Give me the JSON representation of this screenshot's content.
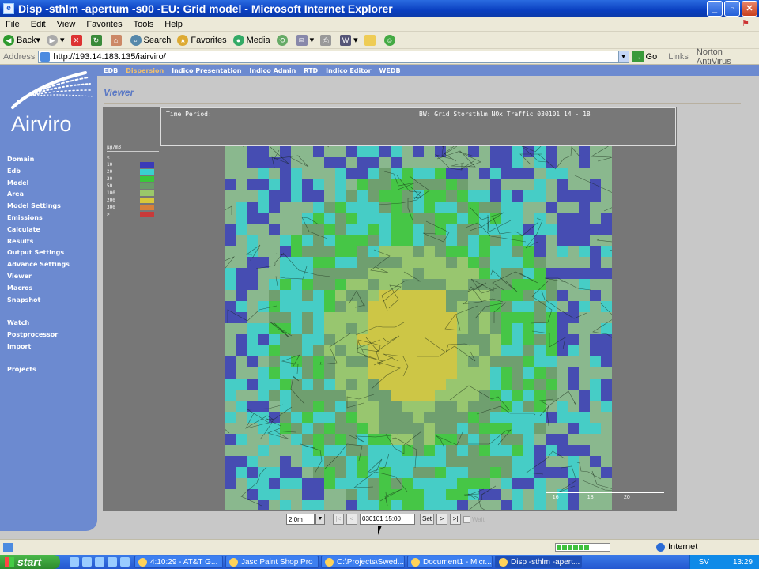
{
  "window": {
    "title": "Disp -sthlm -apertum -s00 -EU: Grid model - Microsoft Internet Explorer"
  },
  "menu": [
    "File",
    "Edit",
    "View",
    "Favorites",
    "Tools",
    "Help"
  ],
  "toolbar": {
    "back": "Back",
    "search": "Search",
    "favorites": "Favorites",
    "media": "Media"
  },
  "address": {
    "label": "Address",
    "url": "http://193.14.183.135/iairviro/",
    "go": "Go",
    "links": "Links",
    "norton": "Norton AntiVirus"
  },
  "app": {
    "logo": "Airviro",
    "section_title": "Viewer"
  },
  "topnav": [
    {
      "label": "EDB",
      "active": false
    },
    {
      "label": "Dispersion",
      "active": true
    },
    {
      "label": "Indico Presentation",
      "active": false
    },
    {
      "label": "Indico Admin",
      "active": false
    },
    {
      "label": "RTD",
      "active": false
    },
    {
      "label": "Indico Editor",
      "active": false
    },
    {
      "label": "WEDB",
      "active": false
    }
  ],
  "sidebar": [
    "Domain",
    "Edb",
    "Model",
    "Area",
    "Model Settings",
    "Emissions",
    "Calculate",
    "Results",
    "Output Settings",
    "Advance Settings",
    "Viewer",
    "Macros",
    "Snapshot",
    "",
    "Watch",
    "Postprocessor",
    "Import",
    "",
    "Projects"
  ],
  "map": {
    "time_period_label": "Time Period:",
    "description": "BW: Grid Storsthlm NOx Traffic 030101 14 - 18",
    "legend_unit": "µg/m3",
    "legend": [
      {
        "label": "<",
        "color": ""
      },
      {
        "label": "10",
        "color": "#3a3ab8"
      },
      {
        "label": "20",
        "color": "#3ad0d0"
      },
      {
        "label": "30",
        "color": "#3ac83a"
      },
      {
        "label": "50",
        "color": "#6a9a6a"
      },
      {
        "label": "100",
        "color": "#9ac86a"
      },
      {
        "label": "200",
        "color": "#d8c83a"
      },
      {
        "label": "300",
        "color": "#d8803a"
      },
      {
        "label": ">",
        "color": "#c83a3a"
      }
    ],
    "scale": [
      "16",
      "18",
      "20"
    ],
    "step": "2.0m",
    "time": "030101 15:00",
    "set": "Set",
    "wait": "Wait"
  },
  "status": {
    "zone": "Internet"
  },
  "taskbar": {
    "start": "start",
    "tasks": [
      "4:10:29 - AT&T G...",
      "Jasc Paint Shop Pro",
      "C:\\Projects\\Swed...",
      "Document1 - Micr...",
      "Disp -sthlm -apert..."
    ],
    "tray_lang": "SV",
    "clock": "13:29"
  }
}
